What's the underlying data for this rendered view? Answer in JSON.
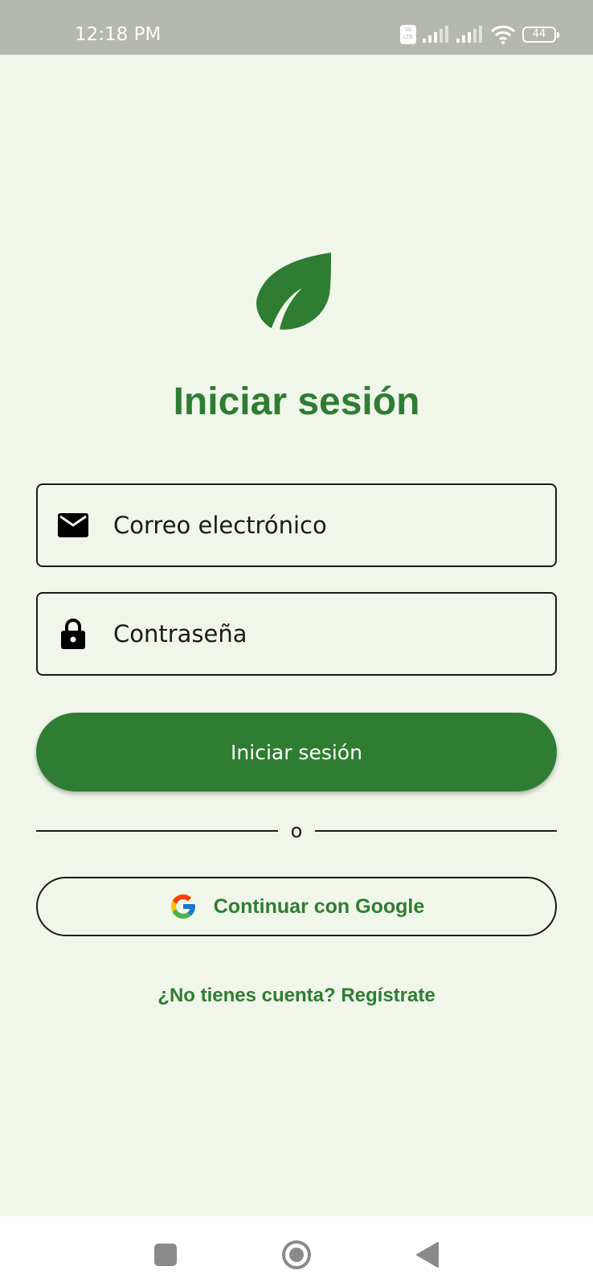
{
  "status_bar": {
    "time": "12:18 PM",
    "volte_label": "Vo LTE",
    "battery_level": "44",
    "icons": [
      "volte-icon",
      "signal-icon",
      "signal-icon",
      "wifi-icon",
      "battery-icon"
    ]
  },
  "login": {
    "logo_icon": "leaf-icon",
    "title": "Iniciar sesión",
    "email": {
      "placeholder": "Correo electrónico",
      "value": "",
      "icon": "mail-icon"
    },
    "password": {
      "placeholder": "Contraseña",
      "value": "",
      "icon": "lock-icon"
    },
    "submit_label": "Iniciar sesión",
    "divider_text": "o",
    "google_label": "Continuar con Google",
    "google_icon": "google-icon",
    "register_label": "¿No tienes cuenta? Regístrate"
  },
  "nav_bar": {
    "icons": [
      "recents-icon",
      "home-icon",
      "back-icon"
    ]
  },
  "colors": {
    "accent": "#2e7d32",
    "background": "#f1f6ea",
    "status_bar": "#b4b8ae",
    "text": "#1a1a1a"
  }
}
